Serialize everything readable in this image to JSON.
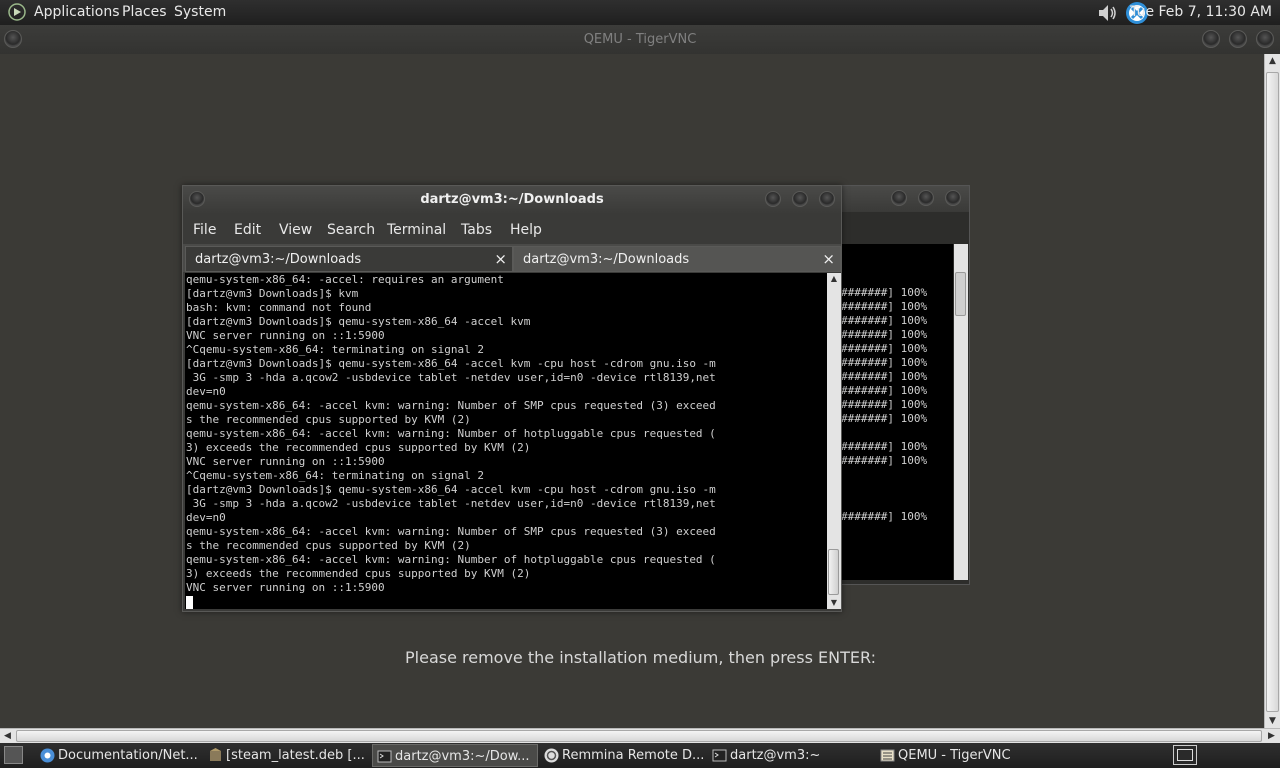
{
  "top_panel": {
    "menus": [
      "Applications",
      "Places",
      "System"
    ],
    "clock": "Tue Feb  7, 11:30 AM"
  },
  "vnc_window": {
    "title": "QEMU - TigerVNC",
    "guest_message": "Please remove the installation medium, then press ENTER:"
  },
  "terminal": {
    "title": "dartz@vm3:~/Downloads",
    "menu": [
      "File",
      "Edit",
      "View",
      "Search",
      "Terminal",
      "Tabs",
      "Help"
    ],
    "tabs": [
      {
        "label": "dartz@vm3:~/Downloads",
        "close": "×"
      },
      {
        "label": "dartz@vm3:~/Downloads",
        "close": "×"
      }
    ],
    "lines": [
      "qemu-system-x86_64: -accel: requires an argument",
      "[dartz@vm3 Downloads]$ kvm",
      "bash: kvm: command not found",
      "[dartz@vm3 Downloads]$ qemu-system-x86_64 -accel kvm",
      "VNC server running on ::1:5900",
      "^Cqemu-system-x86_64: terminating on signal 2",
      "[dartz@vm3 Downloads]$ qemu-system-x86_64 -accel kvm -cpu host -cdrom gnu.iso -m",
      " 3G -smp 3 -hda a.qcow2 -usbdevice tablet -netdev user,id=n0 -device rtl8139,net",
      "dev=n0",
      "qemu-system-x86_64: -accel kvm: warning: Number of SMP cpus requested (3) exceed",
      "s the recommended cpus supported by KVM (2)",
      "qemu-system-x86_64: -accel kvm: warning: Number of hotpluggable cpus requested (",
      "3) exceeds the recommended cpus supported by KVM (2)",
      "VNC server running on ::1:5900",
      "^Cqemu-system-x86_64: terminating on signal 2",
      "[dartz@vm3 Downloads]$ qemu-system-x86_64 -accel kvm -cpu host -cdrom gnu.iso -m",
      " 3G -smp 3 -hda a.qcow2 -usbdevice tablet -netdev user,id=n0 -device rtl8139,net",
      "dev=n0",
      "qemu-system-x86_64: -accel kvm: warning: Number of SMP cpus requested (3) exceed",
      "s the recommended cpus supported by KVM (2)",
      "qemu-system-x86_64: -accel kvm: warning: Number of hotpluggable cpus requested (",
      "3) exceeds the recommended cpus supported by KVM (2)",
      "VNC server running on ::1:5900"
    ]
  },
  "bg_terminal": {
    "lines": [
      "",
      "",
      "",
      "#######] 100%",
      "#######] 100%",
      "#######] 100%",
      "#######] 100%",
      "#######] 100%",
      "#######] 100%",
      "#######] 100%",
      "#######] 100%",
      "#######] 100%",
      "#######] 100%",
      "",
      "#######] 100%",
      "#######] 100%",
      "",
      "",
      "",
      "#######] 100%"
    ]
  },
  "taskbar": {
    "tasks": [
      {
        "label": "Documentation/Net...",
        "active": false
      },
      {
        "label": "[steam_latest.deb [...",
        "active": false
      },
      {
        "label": "dartz@vm3:~/Dow...",
        "active": true
      },
      {
        "label": "Remmina Remote D...",
        "active": false
      },
      {
        "label": "dartz@vm3:~",
        "active": false
      },
      {
        "label": "QEMU - TigerVNC",
        "active": false
      }
    ]
  },
  "colors": {
    "panel": "#252525",
    "desktop": "#3b3a36",
    "terminal_bg": "#000000",
    "terminal_fg": "#d0d0d0"
  }
}
